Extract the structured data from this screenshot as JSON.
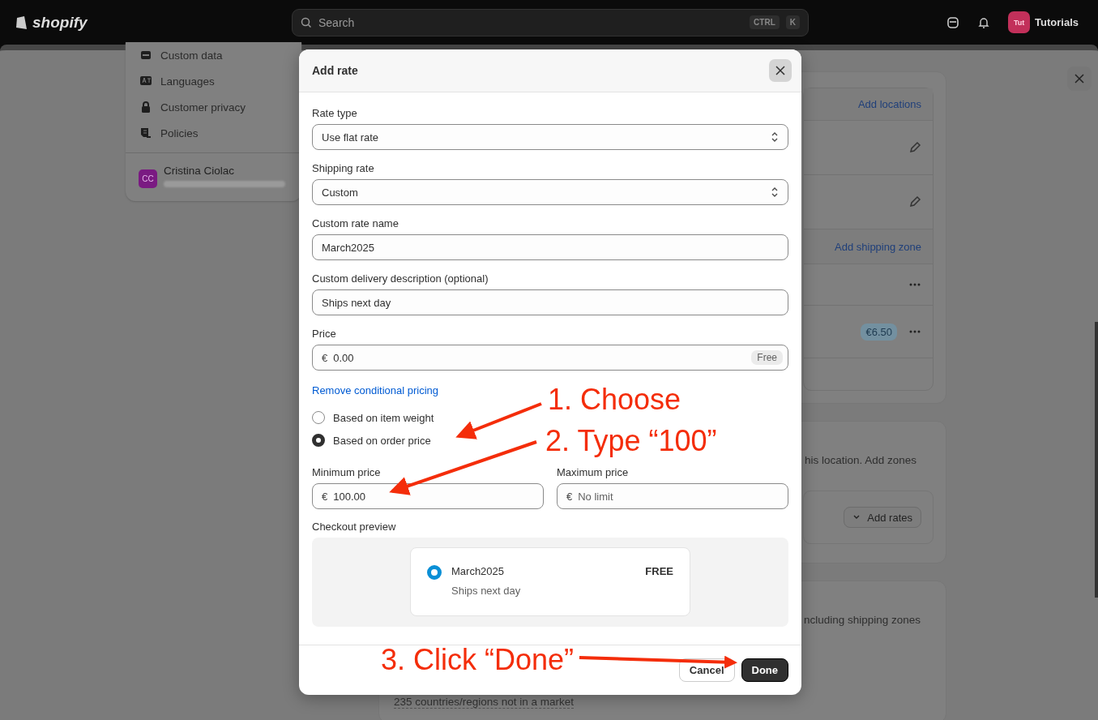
{
  "top_bar": {
    "logo": "shopify",
    "search_placeholder": "Search",
    "shortcut_keys": [
      "CTRL",
      "K"
    ],
    "store_avatar": "Tut",
    "store_name": "Tutorials"
  },
  "sidebar": {
    "items": [
      "Custom data",
      "Languages",
      "Customer privacy",
      "Policies"
    ],
    "user": {
      "initials": "CC",
      "name": "Cristina Ciolac"
    }
  },
  "background": {
    "add_locations": "Add locations",
    "add_shipping_zone": "Add shipping zone",
    "rate_badge": "€6.50",
    "zones_text": "his location. Add zones",
    "add_rates": "Add rates",
    "markets_text": "ncluding shipping zones",
    "market_row": "235 countries/regions not in a market"
  },
  "modal": {
    "title": "Add rate",
    "fields": [
      {
        "kind": "select",
        "label": "Rate type",
        "value": "Use flat rate"
      },
      {
        "kind": "select",
        "label": "Shipping rate",
        "value": "Custom"
      },
      {
        "kind": "text",
        "label": "Custom rate name",
        "value": "March2025"
      },
      {
        "kind": "text",
        "label": "Custom delivery description (optional)",
        "value": "Ships next day"
      },
      {
        "kind": "price",
        "label": "Price",
        "prefix": "€",
        "value": "0.00",
        "badge": "Free"
      }
    ],
    "link": "Remove conditional pricing",
    "conditions": [
      {
        "label": "Based on item weight",
        "selected": false
      },
      {
        "label": "Based on order price",
        "selected": true
      }
    ],
    "range": [
      {
        "label": "Minimum price",
        "prefix": "€",
        "value": "100.00"
      },
      {
        "label": "Maximum price",
        "prefix": "€",
        "placeholder": "No limit"
      }
    ],
    "preview": {
      "label": "Checkout preview",
      "name": "March2025",
      "description": "Ships next day",
      "price": "FREE",
      "selected": true
    },
    "buttons": [
      {
        "label": "Cancel",
        "kind": "secondary"
      },
      {
        "label": "Done",
        "kind": "primary"
      }
    ]
  },
  "annotations": [
    {
      "text": "1. Choose"
    },
    {
      "text": "2. Type “100”"
    },
    {
      "text": "3. Click “Done”"
    }
  ]
}
